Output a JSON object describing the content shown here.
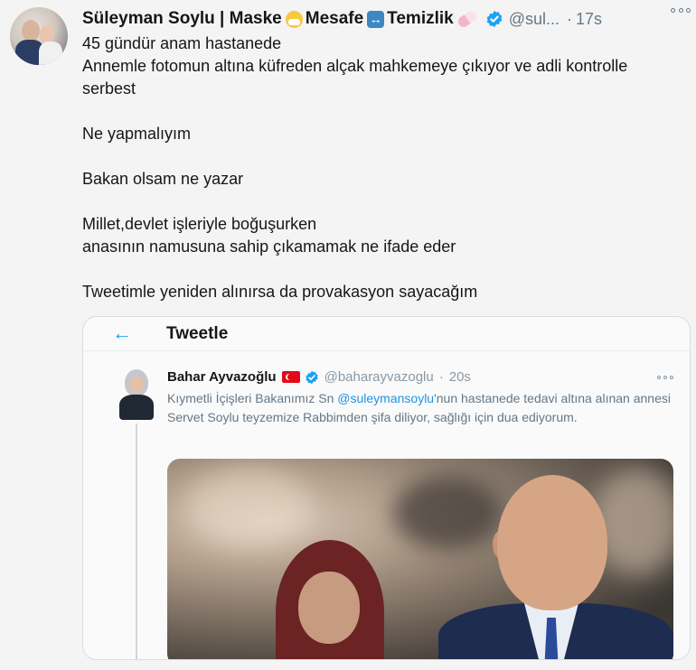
{
  "tweet": {
    "author_name": "Süleyman Soylu | Maske",
    "name_part2": "Mesafe",
    "name_part3": "Temizlik",
    "handle": "@sul...",
    "dot": "·",
    "time": "17s",
    "lines": [
      "45 gündür anam hastanede\nAnnemle fotomun altına küfreden alçak mahkemeye çıkıyor ve adli kontrolle serbest",
      "Ne yapmalıyım",
      "Bakan olsam ne yazar",
      "Millet,devlet işleriyle boğuşurken\nanasının namusuna sahip çıkamamak ne ifade eder",
      "Tweetimle yeniden alınırsa da provakasyon sayacağım"
    ]
  },
  "quote": {
    "title": "Tweetle",
    "back_icon": "←",
    "inner": {
      "name": "Bahar Ayvazoğlu",
      "handle": "@baharayvazoglu",
      "dot": "·",
      "time": "20s",
      "text_before": "Kıymetli İçişleri Bakanımız Sn ",
      "mention": "@suleymansoylu",
      "text_after": "'nun hastanede tedavi altına alınan annesi Servet Soylu teyzemize Rabbimden şifa diliyor, sağlığı için dua ediyorum."
    }
  },
  "colors": {
    "accent": "#1da1f2",
    "verified": "#1da1f2",
    "secondary_text": "#657786",
    "flag_red": "#e30a17"
  },
  "icons": {
    "emoji_1": "face-with-medical-mask-icon",
    "emoji_2": "left-right-arrow-icon",
    "emoji_3": "pill-icon",
    "verified": "verified-badge-icon",
    "more": "more-options-icon",
    "back": "back-arrow-icon",
    "flag": "turkey-flag-icon"
  }
}
